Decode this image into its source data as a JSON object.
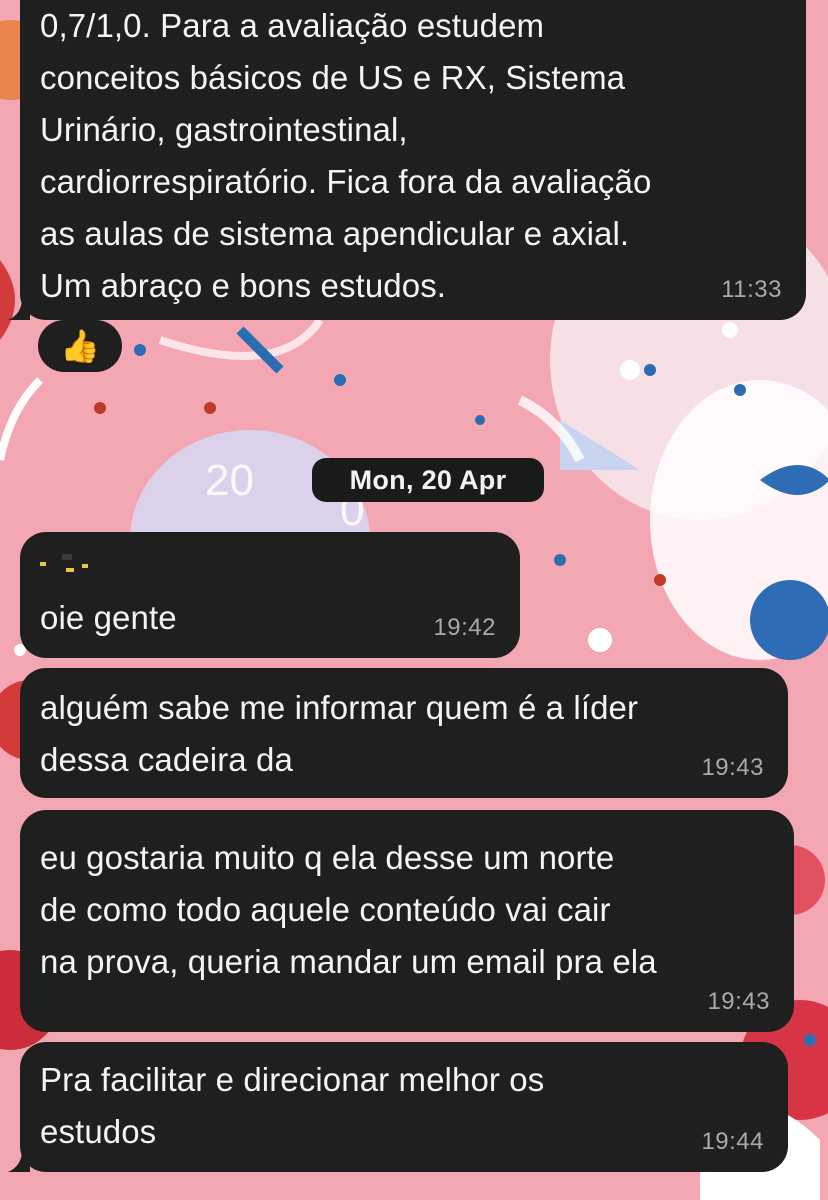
{
  "messages": [
    {
      "text": "0,7/1,0. Para a avaliação estudem\nconceitos básicos de US e RX, Sistema\nUrinário, gastrointestinal,\ncardiorrespiratório. Fica fora da avaliação\nas aulas de sistema apendicular e axial.\nUm abraço e bons estudos.",
      "time": "11:33"
    },
    {
      "text": "oie gente",
      "time": "19:42"
    },
    {
      "text": "alguém sabe me informar quem é a líder\ndessa cadeira da ",
      "time": "19:43"
    },
    {
      "text": "eu gostaria muito q ela desse um norte\nde como todo aquele conteúdo vai cair\nna prova, queria mandar um email pra ela",
      "time": "19:43"
    },
    {
      "text": "Pra facilitar e direcionar melhor os\nestudos",
      "time": "19:44"
    }
  ],
  "reaction": {
    "emoji": "👍",
    "icon": "thumbs-up-icon"
  },
  "date_separator": "Mon, 20 Apr",
  "colors": {
    "bubble": "#1f1f20",
    "wallpaper": "#f3a7b3",
    "timestamp": "#a9a9ab"
  }
}
